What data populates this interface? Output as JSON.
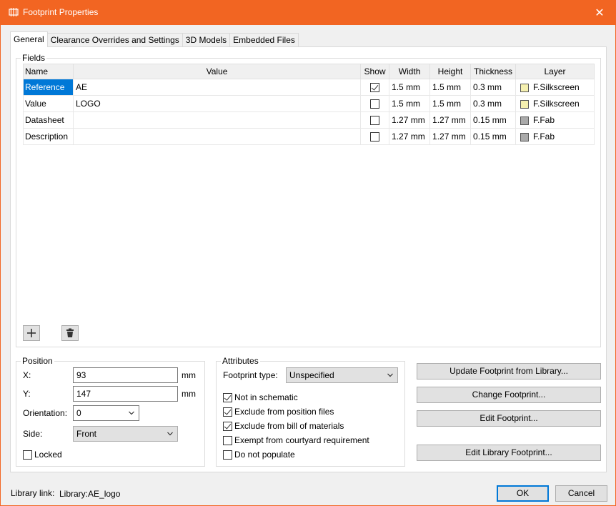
{
  "window": {
    "title": "Footprint Properties",
    "close_glyph": "✕"
  },
  "tabs": [
    {
      "label": "General",
      "active": true
    },
    {
      "label": "Clearance Overrides and Settings"
    },
    {
      "label": "3D Models"
    },
    {
      "label": "Embedded Files"
    }
  ],
  "fields": {
    "group_label": "Fields",
    "columns": [
      "Name",
      "Value",
      "Show",
      "Width",
      "Height",
      "Thickness",
      "Layer"
    ],
    "rows": [
      {
        "name": "Reference",
        "value": "AE",
        "show": true,
        "width": "1.5 mm",
        "height": "1.5 mm",
        "thickness": "0.3 mm",
        "layer": "F.Silkscreen",
        "layer_color": "#f5f0b0",
        "selected": true
      },
      {
        "name": "Value",
        "value": "LOGO",
        "show": false,
        "width": "1.5 mm",
        "height": "1.5 mm",
        "thickness": "0.3 mm",
        "layer": "F.Silkscreen",
        "layer_color": "#f5f0b0"
      },
      {
        "name": "Datasheet",
        "value": "",
        "show": false,
        "width": "1.27 mm",
        "height": "1.27 mm",
        "thickness": "0.15 mm",
        "layer": "F.Fab",
        "layer_color": "#aaaaaa"
      },
      {
        "name": "Description",
        "value": "",
        "show": false,
        "width": "1.27 mm",
        "height": "1.27 mm",
        "thickness": "0.15 mm",
        "layer": "F.Fab",
        "layer_color": "#aaaaaa"
      }
    ],
    "add_icon": "plus-icon",
    "delete_icon": "trash-icon"
  },
  "position": {
    "group_label": "Position",
    "x_label": "X:",
    "x_value": "93",
    "x_unit": "mm",
    "y_label": "Y:",
    "y_value": "147",
    "y_unit": "mm",
    "orientation_label": "Orientation:",
    "orientation_value": "0",
    "side_label": "Side:",
    "side_value": "Front",
    "locked_label": "Locked",
    "locked": false
  },
  "attributes": {
    "group_label": "Attributes",
    "type_label": "Footprint type:",
    "type_value": "Unspecified",
    "options": [
      {
        "label": "Not in schematic",
        "checked": true
      },
      {
        "label": "Exclude from position files",
        "checked": true
      },
      {
        "label": "Exclude from bill of materials",
        "checked": true
      },
      {
        "label": "Exempt from courtyard requirement",
        "checked": false
      },
      {
        "label": "Do not populate",
        "checked": false
      }
    ]
  },
  "actions": {
    "update": "Update Footprint from Library...",
    "change": "Change Footprint...",
    "edit": "Edit Footprint...",
    "edit_lib": "Edit Library Footprint..."
  },
  "footer": {
    "library_link_label": "Library link:",
    "library_link_value": "Library:AE_logo",
    "ok": "OK",
    "cancel": "Cancel"
  },
  "colors": {
    "accent": "#f26522",
    "selection": "#0078d7"
  }
}
